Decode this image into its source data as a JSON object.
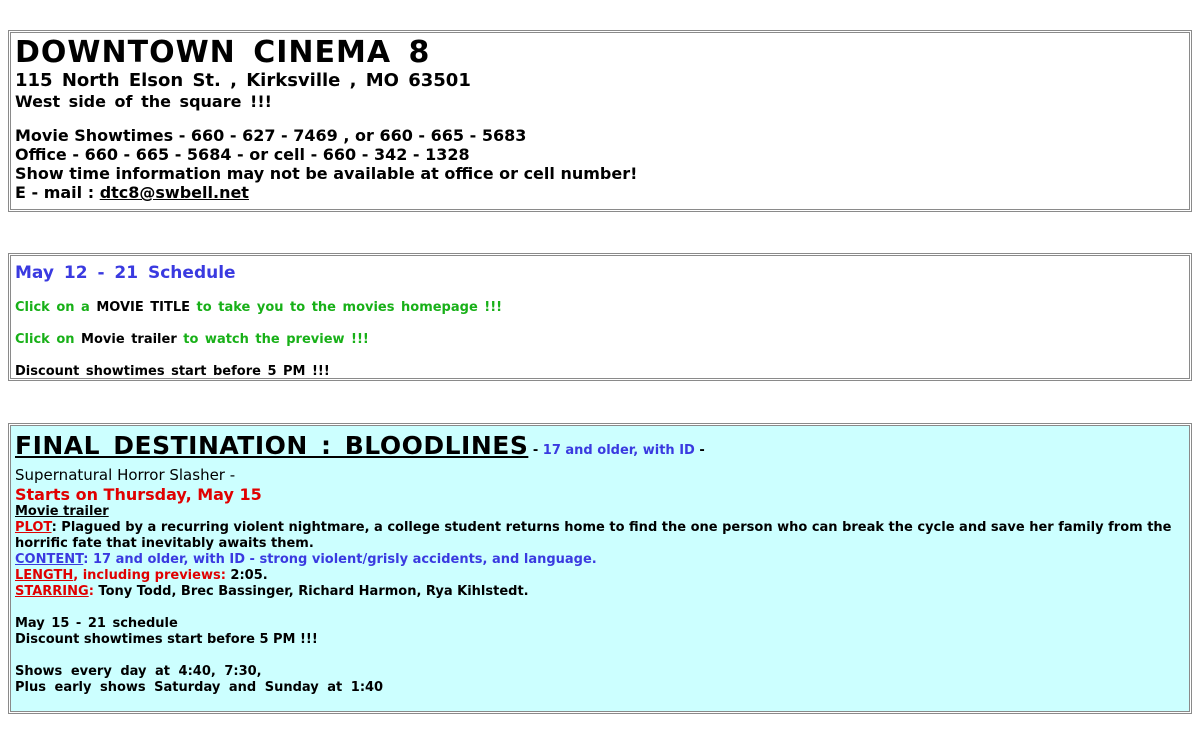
{
  "header": {
    "title": "DOWNTOWN  CINEMA  8",
    "address": "115  North Elson St. ,  Kirksville ,  MO  63501",
    "location_note": "West  side  of  the  square !!!",
    "showtimes_phone": "Movie  Showtimes - 660 - 627 - 7469 , or  660 - 665 - 5683",
    "office_phone": "Office - 660 - 665 - 5684 - or cell - 660 - 342 - 1328",
    "disclaimer": "Show time information may not be available at office or cell number!",
    "email_label": "E - mail  : ",
    "email": "dtc8@swbell.net"
  },
  "schedule": {
    "title": "May  12  -  21  Schedule",
    "click_title_prefix": "Click on  a ",
    "click_title_key": "MOVIE TITLE",
    "click_title_suffix": " to  take  you  to  the  movies  homepage !!!",
    "click_trailer_prefix": "Click on ",
    "click_trailer_key": "Movie trailer",
    "click_trailer_suffix": " to watch the preview !!!",
    "discount": "Discount showtimes start before 5 PM !!!"
  },
  "movie": {
    "title": "FINAL  DESTINATION :  BLOODLINES",
    "rating_prefix": " - ",
    "rating": "17 and older, with ID",
    "rating_suffix": "  -",
    "genre": "Supernatural Horror Slasher -",
    "starts": "Starts on Thursday, May 15",
    "trailer_link": "Movie trailer",
    "plot_label": "PLOT",
    "plot_text": ": Plagued by a recurring violent nightmare, a college student returns home to find the one person who can break the cycle and save her family from the horrific fate that inevitably awaits them.",
    "content_label": "CONTENT",
    "content_text": ":  17 and older, with ID - strong violent/grisly accidents, and language.",
    "length_label": "LENGTH",
    "length_text": ", including previews:",
    "length_value": "  2:05.",
    "starring_label": "STARRING",
    "starring_colon": ":",
    "starring_text": "  Tony Todd, Brec Bassinger, Richard Harmon, Rya Kihlstedt.",
    "schedule_range": "May  15  -  21  schedule",
    "discount": "Discount showtimes start before 5 PM !!!",
    "shows_daily": "Shows  every  day  at  4:40,  7:30,",
    "early_shows": "Plus  early  shows  Saturday  and  Sunday  at  1:40"
  },
  "colors": {
    "blue_text": "#3a3ae0",
    "green_text": "#18b018",
    "red_text": "#e00000",
    "movie_bg": "#ccffff",
    "border": "#8a8a8a"
  }
}
